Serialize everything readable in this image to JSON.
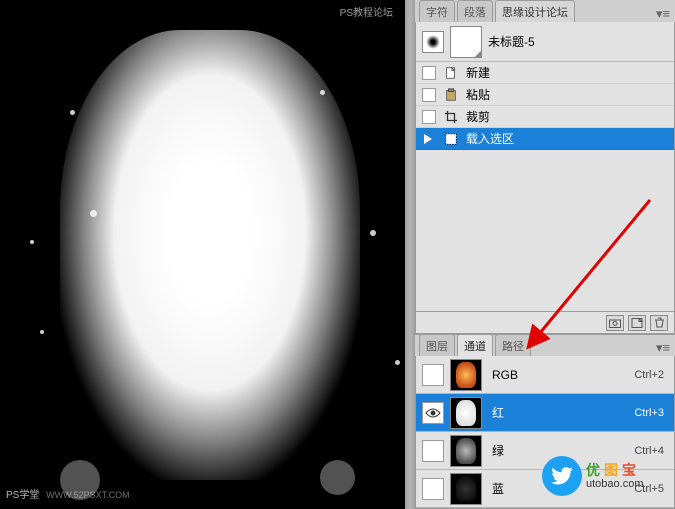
{
  "watermark": {
    "top": "PS教程论坛",
    "bottom_left": "PS学堂",
    "bottom_url": "WWW.52PSXT.COM"
  },
  "doc_title": "未标题-5",
  "top_tabs": [
    "字符",
    "段落",
    "思缘设计论坛"
  ],
  "history": {
    "items": [
      {
        "label": "新建",
        "icon": "new"
      },
      {
        "label": "粘贴",
        "icon": "paste"
      },
      {
        "label": "裁剪",
        "icon": "crop"
      },
      {
        "label": "载入选区",
        "icon": "load-selection",
        "selected": true
      }
    ]
  },
  "channels_tabs": [
    "图层",
    "通道",
    "路径"
  ],
  "channels": {
    "items": [
      {
        "label": "RGB",
        "shortcut": "Ctrl+2",
        "eye": false,
        "thumb_color": "orange"
      },
      {
        "label": "红",
        "shortcut": "Ctrl+3",
        "eye": true,
        "selected": true,
        "thumb_color": "white"
      },
      {
        "label": "绿",
        "shortcut": "Ctrl+4",
        "eye": false,
        "thumb_color": "lightgrey"
      },
      {
        "label": "蓝",
        "shortcut": "Ctrl+5",
        "eye": false,
        "thumb_color": "dark"
      }
    ]
  },
  "brand": {
    "cn1": "优",
    "cn2": "图",
    "cn3": "宝",
    "url": "utobao.com"
  }
}
